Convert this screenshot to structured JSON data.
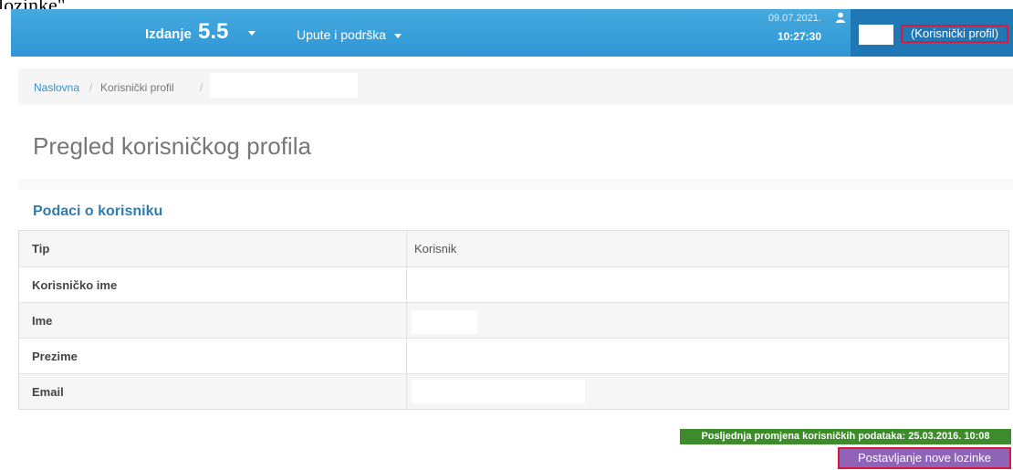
{
  "top_fragment": "lozinke\".",
  "navbar": {
    "edition_label": "Izdanje",
    "edition_value": "5.5",
    "help_label": "Upute i podrška",
    "date": "09.07.2021.",
    "time": "10:27:30",
    "profile_link": "(Korisnički profil)"
  },
  "breadcrumb": {
    "home": "Naslovna",
    "separator": "/",
    "profile": "Korisnički profil"
  },
  "page_title": "Pregled korisničkog profila",
  "section_heading": "Podaci o korisniku",
  "user_info": {
    "rows": [
      {
        "label": "Tip",
        "value": "Korisnik"
      },
      {
        "label": "Korisničko ime",
        "value": ""
      },
      {
        "label": "Ime",
        "value": ""
      },
      {
        "label": "Prezime",
        "value": ""
      },
      {
        "label": "Email",
        "value": ""
      }
    ]
  },
  "last_change_badge": "Posljednja promjena korisničkih podataka: 25.03.2016. 10:08",
  "new_password_button": "Postavljanje nove lozinke",
  "colors": {
    "navbar": "#2f97d4",
    "user_box": "#1f78b5",
    "highlight_border": "#d81b3a",
    "badge_green": "#3d8b2b",
    "button_purple": "#8e63b8",
    "link_blue": "#3a8fc8"
  }
}
